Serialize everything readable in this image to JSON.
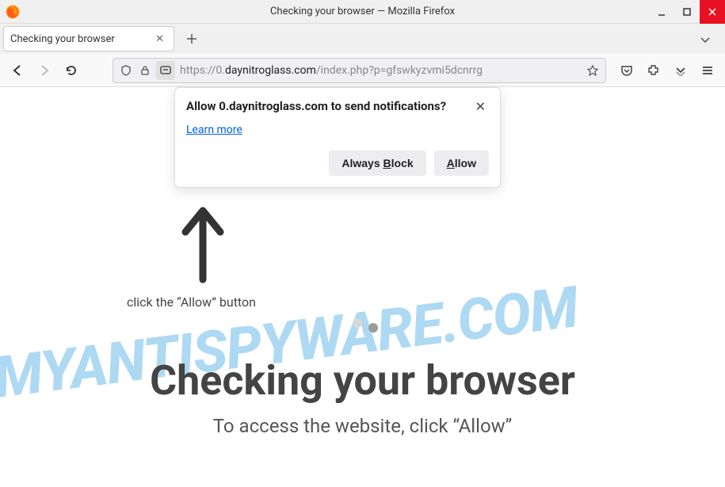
{
  "window": {
    "title": "Checking your browser — Mozilla Firefox"
  },
  "tab": {
    "title": "Checking your browser"
  },
  "urlbar": {
    "prefix": "https://0.",
    "domain": "daynitroglass.com",
    "path": "/index.php?p=gfswkyzvmi5dcnrrg"
  },
  "notification": {
    "title": "Allow 0.daynitroglass.com to send notifications?",
    "learn_more": "Learn more",
    "block_prefix": "Always ",
    "block_key": "B",
    "block_suffix": "lock",
    "allow_key": "A",
    "allow_suffix": "llow"
  },
  "page": {
    "instruction": "click the “Allow” button",
    "heading": "Checking your browser",
    "subtext": "To access the website, click “Allow”"
  },
  "watermark": "MYANTISPYWARE.COM"
}
